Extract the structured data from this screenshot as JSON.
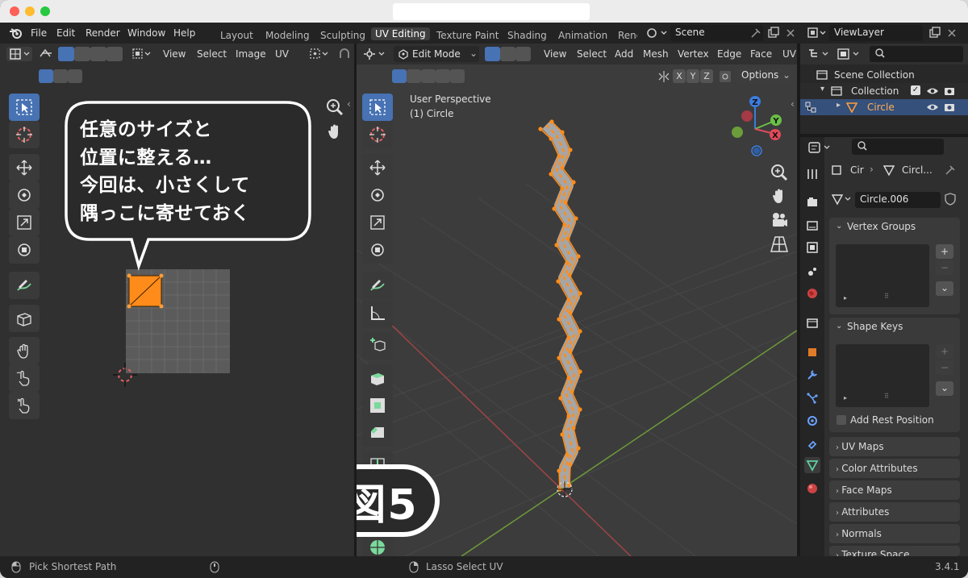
{
  "menubar": {
    "items": [
      "File",
      "Edit",
      "Render",
      "Window",
      "Help"
    ]
  },
  "workspaces": [
    "Layout",
    "Modeling",
    "Sculpting",
    "UV Editing",
    "Texture Paint",
    "Shading",
    "Animation",
    "Rend"
  ],
  "scene": {
    "name": "Scene"
  },
  "view_layer": {
    "name": "ViewLayer"
  },
  "uv_editor": {
    "menu": [
      "View",
      "Select",
      "Image",
      "UV"
    ],
    "callout": {
      "lines": [
        "任意のサイズと",
        "位置に整える…",
        "今回は、小さくして",
        "隅っこに寄せておく"
      ]
    }
  },
  "viewport": {
    "mode": "Edit Mode",
    "menu": [
      "View",
      "Select",
      "Add",
      "Mesh",
      "Vertex",
      "Edge",
      "Face",
      "UV"
    ],
    "xyz": [
      "X",
      "Y",
      "Z"
    ],
    "options": "Options",
    "perspective": "User Perspective",
    "object_label": "(1) Circle",
    "figure_label": "図5",
    "gizmo": {
      "x": "X",
      "y": "Y",
      "z": "Z"
    }
  },
  "outliner": {
    "scene_collection": "Scene Collection",
    "collection": "Collection",
    "object": "Circle"
  },
  "properties": {
    "breadcrumb_object": "Cir",
    "breadcrumb_mesh": "Circl...",
    "mesh_name": "Circle.006",
    "sections": {
      "vertex_groups": "Vertex Groups",
      "shape_keys": "Shape Keys",
      "add_rest_position": "Add Rest Position",
      "uv_maps": "UV Maps",
      "color_attributes": "Color Attributes",
      "face_maps": "Face Maps",
      "attributes": "Attributes",
      "normals": "Normals",
      "texture_space": "Texture Space"
    }
  },
  "statusbar": {
    "left": "Pick Shortest Path",
    "middle": "Lasso Select UV",
    "version": "3.4.1"
  },
  "colors": {
    "accent": "#4772b3",
    "selection": "#ff8c1a",
    "bg": "#2b2b2b"
  }
}
